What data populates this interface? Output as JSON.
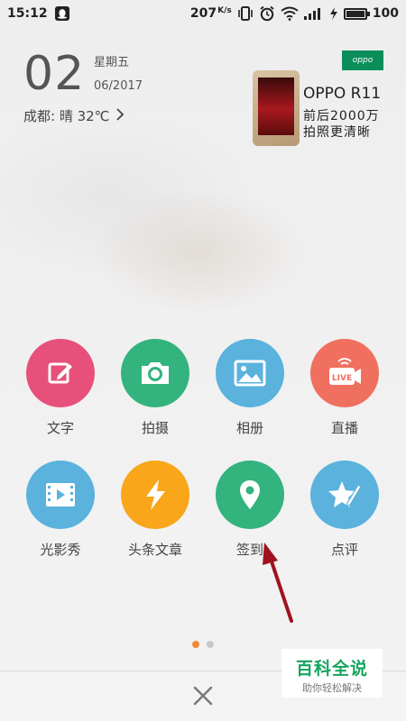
{
  "status_bar": {
    "time": "15:12",
    "net_speed": "207",
    "net_unit": "K/s",
    "battery": "100",
    "battery_level_pct": 100,
    "icons": [
      "qq-icon",
      "vibrate-icon",
      "alarm-icon",
      "wifi-icon",
      "signal-icon",
      "charging-icon",
      "battery-icon"
    ]
  },
  "header": {
    "day": "02",
    "weekday": "星期五",
    "month_year": "06/2017",
    "weather": "成都: 晴 32℃"
  },
  "ad": {
    "brand_logo": "oppo",
    "title": "OPPO R11",
    "line1": "前后2000万",
    "line2": "拍照更清晰"
  },
  "grid": {
    "items": [
      {
        "label": "文字",
        "icon": "edit-icon",
        "color": "#e7507b"
      },
      {
        "label": "拍摄",
        "icon": "camera-icon",
        "color": "#33b37e"
      },
      {
        "label": "相册",
        "icon": "image-icon",
        "color": "#5ab2dd"
      },
      {
        "label": "直播",
        "icon": "live-icon",
        "color": "#f0705f"
      },
      {
        "label": "光影秀",
        "icon": "video-icon",
        "color": "#5ab2dd"
      },
      {
        "label": "头条文章",
        "icon": "lightning-icon",
        "color": "#f9a61a"
      },
      {
        "label": "签到",
        "icon": "location-pin-icon",
        "color": "#33b37e"
      },
      {
        "label": "点评",
        "icon": "star-pen-icon",
        "color": "#5ab2dd"
      }
    ]
  },
  "pager": {
    "count": 2,
    "active": 0,
    "active_color": "#f08a35"
  },
  "watermark": {
    "main": "百科全说",
    "sub": "助你轻松解决"
  },
  "annotation": {
    "arrow_color": "#a0121e"
  }
}
